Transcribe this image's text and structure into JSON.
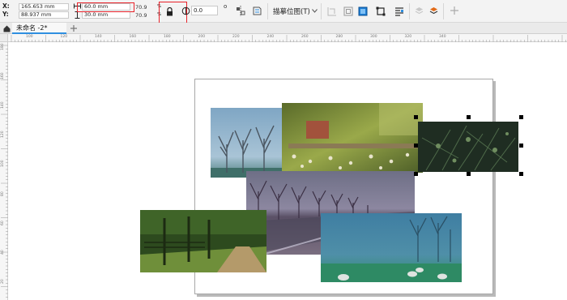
{
  "property_bar": {
    "x_label": "X:",
    "y_label": "Y:",
    "x_value": "165.653 mm",
    "y_value": "88.937 mm",
    "width_value": "60.0 mm",
    "height_value": "30.0 mm",
    "scale_x": "70.9",
    "scale_y": "70.9",
    "percent_x": "%",
    "percent_y": "%",
    "rotation_value": "0.0",
    "rotation_unit": "o",
    "trace_bitmap_label": "描摹位图(T)",
    "highlight_color": "#e8222a"
  },
  "tabs": {
    "document_tab_label": "未命名 -2*"
  },
  "rulers": {
    "horizontal": [
      "100",
      "120",
      "140",
      "160",
      "180",
      "200",
      "220",
      "240",
      "260",
      "280",
      "300",
      "320",
      "340"
    ],
    "vertical": [
      "180",
      "160",
      "140",
      "120",
      "100",
      "80",
      "60",
      "40",
      "20"
    ]
  },
  "colors": {
    "selection_accent": "#2f8fe0",
    "toolbar_bg": "#f3f3f3"
  }
}
